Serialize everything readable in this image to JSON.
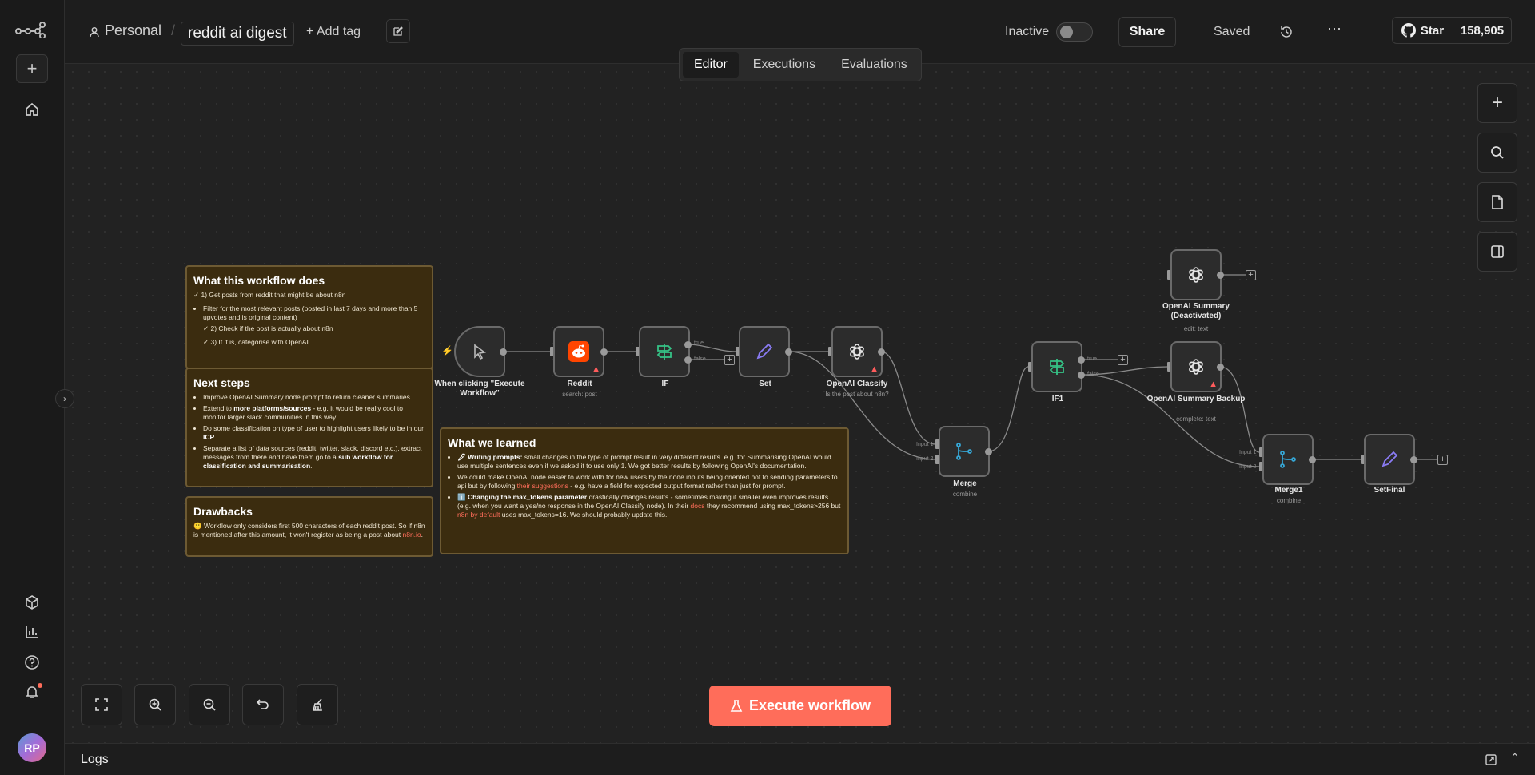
{
  "header": {
    "project": "Personal",
    "workflow_name": "reddit ai digest",
    "add_tag": "+ Add tag",
    "status": "Inactive",
    "share": "Share",
    "saved": "Saved",
    "github_star": "Star",
    "github_count": "158,905"
  },
  "tabs": [
    "Editor",
    "Executions",
    "Evaluations"
  ],
  "execute_label": "Execute workflow",
  "logs_label": "Logs",
  "avatar_initials": "RP",
  "notes": {
    "what": {
      "title": "What this workflow does",
      "step1": "✓ 1) Get posts from reddit that might be about n8n",
      "bullet": "Filter for the most relevant posts (posted in last 7 days and more than 5 upvotes and is original content)",
      "step2": "✓ 2) Check if the post is actually about n8n",
      "step3": "✓ 3) If it is, categorise with OpenAI."
    },
    "next": {
      "title": "Next steps",
      "b1": "Improve OpenAI Summary node prompt to return cleaner summaries.",
      "b2_pre": "Extend to ",
      "b2_bold": "more platforms/sources",
      "b2_post": " - e.g. it would be really cool to monitor larger slack communities in this way.",
      "b3_pre": "Do some classification on type of user to highlight users likely to be in our ",
      "b3_bold": "ICP",
      "b3_post": ".",
      "b4_pre": "Separate a list of data sources (reddit, twitter, slack, discord etc.), extract messages from there and have them go to a ",
      "b4_bold": "sub workflow for classification and summarisation",
      "b4_post": "."
    },
    "drawbacks": {
      "title": "Drawbacks",
      "text": "🙁 Workflow only considers first 500 characters of each reddit post. So if n8n is mentioned after this amount, it won't register as being a post about ",
      "link": "n8n.io",
      "end": "."
    },
    "learned": {
      "title": "What we learned",
      "b1_bold": "🖋 Writing prompts:",
      "b1_text": " small changes in the type of prompt result in very different results. e.g. for Summarising OpenAI would use multiple sentences even if we asked it to use only 1. We got better results by following OpenAI's documentation.",
      "b2_pre": "We could make OpenAI node easier to work with for new users by the node inputs being oriented not to sending parameters to api but by following ",
      "b2_link": "their suggestions",
      "b2_post": " - e.g. have a field for expected output format rather than just for prompt.",
      "b3_bold": "ℹ️ Changing the max_tokens parameter",
      "b3_text": " drastically changes results - sometimes making it smaller even improves results (e.g. when you want a yes/no response in the OpenAI Classify node). In their ",
      "b3_link1": "docs",
      "b3_mid": " they recommend using max_tokens>256 but ",
      "b3_link2": "n8n by default",
      "b3_end": " uses max_tokens=16. We should probably update this."
    }
  },
  "nodes": {
    "trigger": {
      "label": "When clicking \"Execute Workflow\""
    },
    "reddit": {
      "label": "Reddit",
      "sub": "search: post"
    },
    "if": {
      "label": "IF",
      "true": "true",
      "false": "false"
    },
    "set": {
      "label": "Set"
    },
    "classify": {
      "label": "OpenAI Classify",
      "sub": "Is the post about n8n?"
    },
    "merge": {
      "label": "Merge",
      "sub": "combine",
      "in1": "Input 1",
      "in2": "Input 2"
    },
    "if1": {
      "label": "IF1",
      "true": "true",
      "false": "false"
    },
    "summary": {
      "label": "OpenAI Summary (Deactivated)",
      "sub": "edit: text"
    },
    "backup": {
      "label": "OpenAI Summary Backup",
      "sub": "complete: text"
    },
    "merge1": {
      "label": "Merge1",
      "sub": "combine",
      "in1": "Input 1",
      "in2": "Input 2"
    },
    "setfinal": {
      "label": "SetFinal"
    }
  },
  "colors": {
    "accent": "#ff6d5a",
    "sticky_bg": "#3b2c0f",
    "if_green": "#35c286",
    "set_purple": "#8b7cf6",
    "merge_blue": "#36a7d6",
    "reddit_orange": "#ff4500"
  }
}
